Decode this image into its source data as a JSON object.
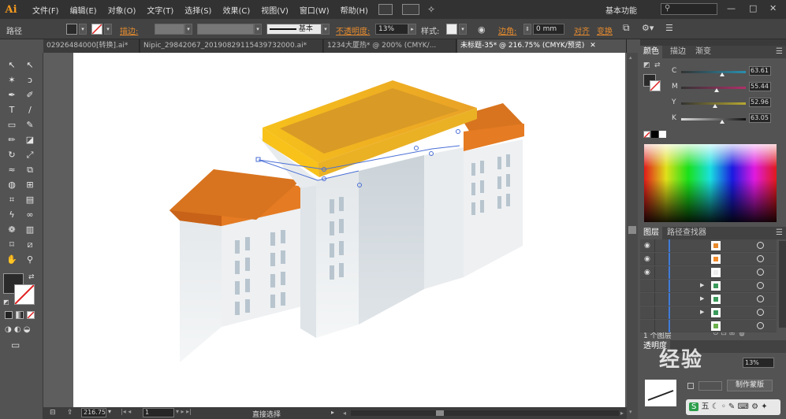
{
  "app": {
    "logo": "Ai"
  },
  "menubar": {
    "items": [
      "文件(F)",
      "编辑(E)",
      "对象(O)",
      "文字(T)",
      "选择(S)",
      "效果(C)",
      "视图(V)",
      "窗口(W)",
      "帮助(H)"
    ],
    "workspace": "基本功能",
    "search_placeholder": "",
    "window_min": "—",
    "window_max": "□",
    "window_close": "✕"
  },
  "control_bar": {
    "selection_label": "路径",
    "stroke_label": "描边:",
    "stroke_value": "",
    "brush_label": "基本",
    "opacity_label": "不透明度:",
    "opacity_value": "13%",
    "style_label": "样式:",
    "corner_label": "边角:",
    "corner_value": "0 mm",
    "align_label": "对齐",
    "transform_label": "变换"
  },
  "tabs": [
    {
      "label": "02926484000[转换].ai*",
      "active": false,
      "close": "✕"
    },
    {
      "label": "Nipic_29842067_20190829115439732000.ai*",
      "active": false,
      "close": "✕"
    },
    {
      "label": "1234大厦热* @ 200% (CMYK/...",
      "active": false,
      "close": "✕"
    },
    {
      "label": "未标题-35* @ 216.75% (CMYK/预览)",
      "active": true,
      "close": "✕"
    }
  ],
  "tools": [
    {
      "name": "selection-tool",
      "glyph": "↖"
    },
    {
      "name": "direct-selection-tool",
      "glyph": "↖"
    },
    {
      "name": "magic-wand-tool",
      "glyph": "✶"
    },
    {
      "name": "lasso-tool",
      "glyph": "ↄ"
    },
    {
      "name": "pen-tool",
      "glyph": "✒"
    },
    {
      "name": "curvature-tool",
      "glyph": "✐"
    },
    {
      "name": "type-tool",
      "glyph": "T"
    },
    {
      "name": "line-tool",
      "glyph": "/"
    },
    {
      "name": "rectangle-tool",
      "glyph": "▭"
    },
    {
      "name": "paintbrush-tool",
      "glyph": "✎"
    },
    {
      "name": "pencil-tool",
      "glyph": "✏"
    },
    {
      "name": "eraser-tool",
      "glyph": "◪"
    },
    {
      "name": "rotate-tool",
      "glyph": "↻"
    },
    {
      "name": "scale-tool",
      "glyph": "⤢"
    },
    {
      "name": "warp-tool",
      "glyph": "≈"
    },
    {
      "name": "free-transform-tool",
      "glyph": "⧉"
    },
    {
      "name": "shape-builder-tool",
      "glyph": "◍"
    },
    {
      "name": "perspective-grid-tool",
      "glyph": "⊞"
    },
    {
      "name": "mesh-tool",
      "glyph": "⌗"
    },
    {
      "name": "gradient-tool",
      "glyph": "▤"
    },
    {
      "name": "eyedropper-tool",
      "glyph": "ϟ"
    },
    {
      "name": "blend-tool",
      "glyph": "∞"
    },
    {
      "name": "symbol-sprayer-tool",
      "glyph": "❁"
    },
    {
      "name": "column-graph-tool",
      "glyph": "▥"
    },
    {
      "name": "artboard-tool",
      "glyph": "⌑"
    },
    {
      "name": "slice-tool",
      "glyph": "⧄"
    },
    {
      "name": "hand-tool",
      "glyph": "✋"
    },
    {
      "name": "zoom-tool",
      "glyph": "⚲"
    }
  ],
  "color_panel": {
    "tabs": [
      "颜色",
      "渐变",
      "渐变"
    ],
    "tab_labels": [
      "颜色",
      "描边",
      "渐变"
    ],
    "channels": [
      {
        "label": "C",
        "value": "63.61",
        "pos": 0.63,
        "gradient": "linear-gradient(90deg,#333,#2a8fae)"
      },
      {
        "label": "M",
        "value": "55.44",
        "pos": 0.55,
        "gradient": "linear-gradient(90deg,#333,#b0306a)"
      },
      {
        "label": "Y",
        "value": "52.96",
        "pos": 0.53,
        "gradient": "linear-gradient(90deg,#333,#b7a832)"
      },
      {
        "label": "K",
        "value": "63.05",
        "pos": 0.63,
        "gradient": "linear-gradient(90deg,#ddd,#111)"
      }
    ]
  },
  "layers_panel": {
    "tabs": [
      "图层",
      "路径查找器"
    ],
    "layer_count": "1 个图层",
    "rows": [
      {
        "eye": true,
        "expand": false,
        "thumb_color": "#e8892b"
      },
      {
        "eye": true,
        "expand": false,
        "thumb_color": "#f28b2a"
      },
      {
        "eye": true,
        "expand": false,
        "thumb_color": "#eeeeee"
      },
      {
        "eye": false,
        "expand": true,
        "thumb_color": "#3a9a5a"
      },
      {
        "eye": false,
        "expand": true,
        "thumb_color": "#3a9a5a"
      },
      {
        "eye": false,
        "expand": true,
        "thumb_color": "#3a9a5a"
      },
      {
        "eye": false,
        "expand": false,
        "thumb_color": "#6ab04c"
      }
    ]
  },
  "transparency_panel": {
    "title": "透明度",
    "opacity_value": "13%",
    "make_mask_label": "制作蒙版"
  },
  "status_bar": {
    "zoom_value": "216.75",
    "page_value": "1",
    "tool_name": "直接选择"
  },
  "watermark": "经验",
  "colors": {
    "roof_orange": "#e8892b",
    "roof_top": "#f1a722",
    "accent_orange": "#e88c2e",
    "selection_blue": "#4a6fd6"
  }
}
